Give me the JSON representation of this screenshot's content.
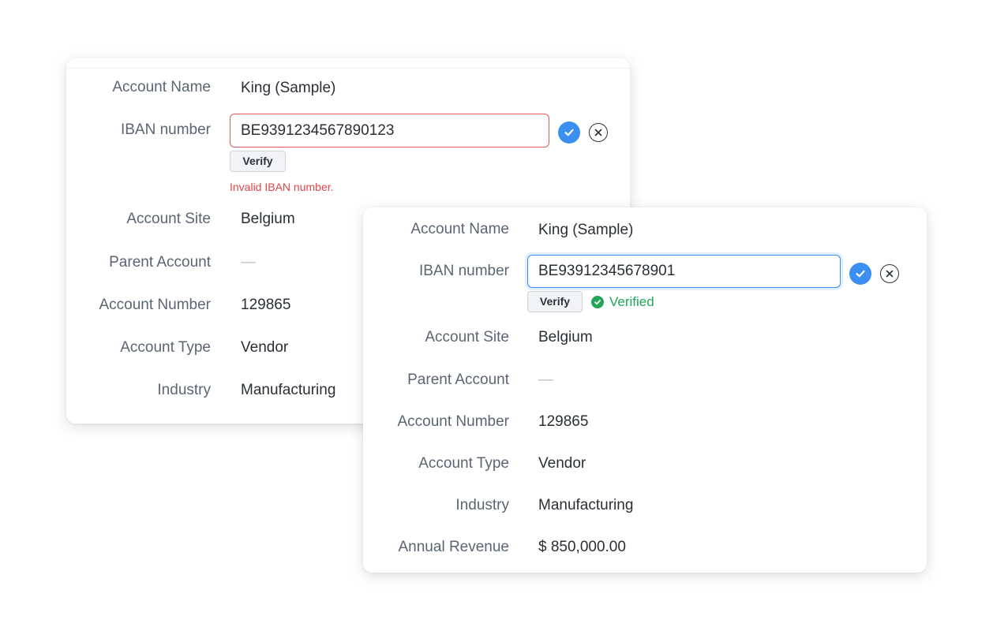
{
  "invalid_card": {
    "account_name": {
      "label": "Account Name",
      "value": "King (Sample)"
    },
    "iban": {
      "label": "IBAN number",
      "value": "BE9391234567890123",
      "verify_label": "Verify",
      "error": "Invalid IBAN number."
    },
    "account_site": {
      "label": "Account Site",
      "value": "Belgium"
    },
    "parent_account": {
      "label": "Parent Account",
      "value": "—"
    },
    "account_number": {
      "label": "Account Number",
      "value": "129865"
    },
    "account_type": {
      "label": "Account Type",
      "value": "Vendor"
    },
    "industry": {
      "label": "Industry",
      "value": "Manufacturing"
    }
  },
  "verified_card": {
    "account_name": {
      "label": "Account Name",
      "value": "King (Sample)"
    },
    "iban": {
      "label": "IBAN number",
      "value": "BE93912345678901",
      "verify_label": "Verify",
      "status": "Verified"
    },
    "account_site": {
      "label": "Account Site",
      "value": "Belgium"
    },
    "parent_account": {
      "label": "Parent Account",
      "value": "—"
    },
    "account_number": {
      "label": "Account Number",
      "value": "129865"
    },
    "account_type": {
      "label": "Account Type",
      "value": "Vendor"
    },
    "industry": {
      "label": "Industry",
      "value": "Manufacturing"
    },
    "annual_revenue": {
      "label": "Annual Revenue",
      "value": "$ 850,000.00"
    }
  },
  "colors": {
    "accent": "#3b8ff0",
    "error": "#e0464a",
    "success": "#22a559"
  },
  "icons": {
    "save": "check-circle-icon",
    "cancel": "close-circle-icon",
    "verified": "verified-check-icon"
  }
}
